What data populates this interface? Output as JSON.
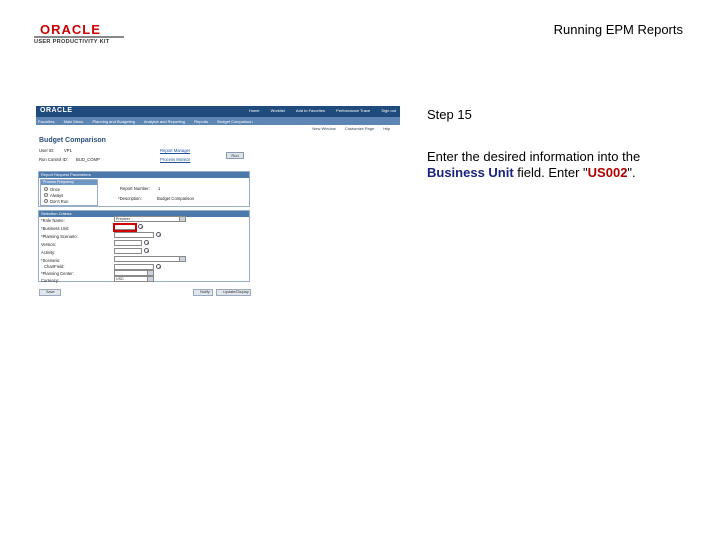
{
  "header": {
    "brand": "ORACLE",
    "subbrand": "USER PRODUCTIVITY KIT",
    "doc_title": "Running EPM Reports"
  },
  "step": {
    "label": "Step 15",
    "instruction_before": "Enter the desired information into the ",
    "field_name": "Business Unit",
    "instruction_middle": " field. Enter \"",
    "value": "US002",
    "instruction_after": "\"."
  },
  "screen": {
    "logo": "ORACLE",
    "top_links": [
      "Home",
      "Worklist",
      "Add to Favorites",
      "Performance Trace",
      "Sign out"
    ],
    "breadcrumb": [
      "Favorites",
      "Main Menu",
      "Planning and Budgeting",
      "Analysis and Reporting",
      "Reports",
      "Budget Comparison"
    ],
    "tools": [
      "New Window",
      "Customize Page",
      "http"
    ],
    "page_title": "Budget Comparison",
    "run_control_label": "User ID:",
    "run_control_value": "VP1",
    "run_control_id_label": "Run Control ID:",
    "run_control_id_value": "BUD_COMP",
    "report_manager_link": "Report Manager",
    "process_monitor_link": "Process Monitor",
    "run_button": "Run",
    "section_report_request": "Report Request Parameters",
    "section_process_frequency": "Process Frequency",
    "radio_once": "Once",
    "radio_always": "Always",
    "radio_dont_run": "Don't Run",
    "report_number_label": "Report Number:",
    "report_number_value": "1",
    "description_label": "*Description:",
    "description_value": "Budget Comparison",
    "section_selection": "Selection Criteria",
    "role_name_label": "*Role Name:",
    "role_name_value": "Preparer",
    "business_unit_label": "*Business Unit:",
    "scenario_label": "*Planning Scenario:",
    "version_label": "Version:",
    "activity_label": "Activity:",
    "scenario2_label": "*Scenario:",
    "chartfield_label": "ChartField:",
    "planning_center_label": "*Planning Center:",
    "currency_label": "Currency:",
    "currency_value": "USD",
    "save_button": "Save",
    "notify_button": "Notify",
    "update_button": "Update/Display"
  }
}
